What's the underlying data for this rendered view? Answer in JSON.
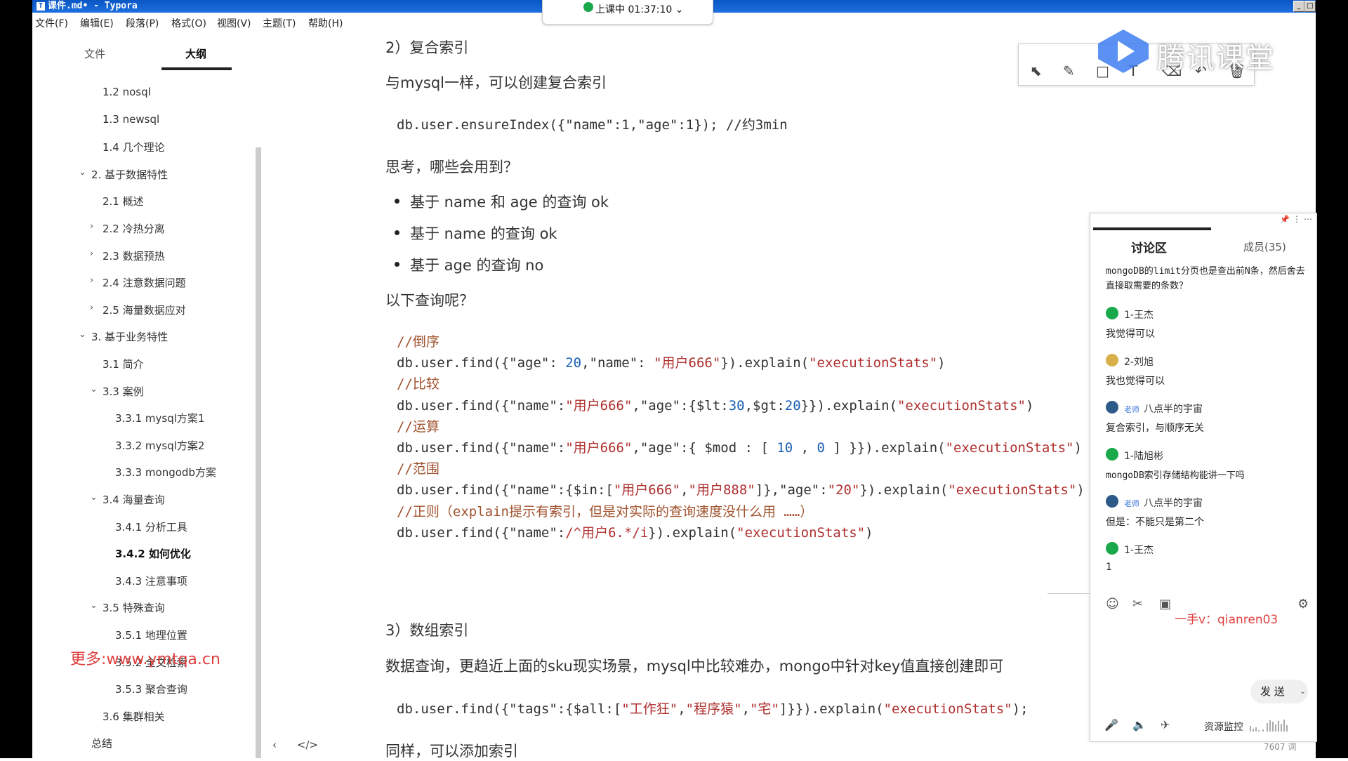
{
  "window": {
    "title": "课件.md• - Typora",
    "icon": "T",
    "controls": [
      "_",
      "□"
    ]
  },
  "menu": [
    "文件(F)",
    "编辑(E)",
    "段落(P)",
    "格式(O)",
    "视图(V)",
    "主题(T)",
    "帮助(H)"
  ],
  "live_status": {
    "text": "上课中 01:37:10",
    "chevron": "⌄"
  },
  "sidebar": {
    "tabs": {
      "files": "文件",
      "outline": "大纲"
    },
    "outline": [
      {
        "label": "1.2 nosql"
      },
      {
        "label": "1.3 newsql"
      },
      {
        "label": "1.4 几个理论"
      },
      {
        "label": "2. 基于数据特性",
        "chev": "⌄"
      },
      {
        "label": "2.1 概述"
      },
      {
        "label": "2.2 冷热分离",
        "chev": "›"
      },
      {
        "label": "2.3 数据预热",
        "chev": "›"
      },
      {
        "label": "2.4 注意数据问题",
        "chev": "›"
      },
      {
        "label": "2.5 海量数据应对",
        "chev": "›"
      },
      {
        "label": "3. 基于业务特性",
        "chev": "⌄"
      },
      {
        "label": "3.1 简介"
      },
      {
        "label": "3.3 案例",
        "chev": "⌄"
      },
      {
        "label": "3.3.1 mysql方案1"
      },
      {
        "label": "3.3.2 mysql方案2"
      },
      {
        "label": "3.3.3 mongodb方案"
      },
      {
        "label": "3.4 海量查询",
        "chev": "⌄"
      },
      {
        "label": "3.4.1 分析工具"
      },
      {
        "label": "3.4.2 如何优化"
      },
      {
        "label": "3.4.3 注意事项"
      },
      {
        "label": "3.5 特殊查询",
        "chev": "⌄"
      },
      {
        "label": "3.5.1 地理位置"
      },
      {
        "label": "3.5.2 全文检索"
      },
      {
        "label": "3.5.3 聚合查询"
      },
      {
        "label": "3.6 集群相关"
      },
      {
        "label": "总结"
      }
    ],
    "watermark": "更多:www.ymtqa.cn",
    "bottom_icons": {
      "collapse": "‹",
      "source": "</>"
    }
  },
  "doc": {
    "h_compound": "2）复合索引",
    "p_same_mysql": "与mysql一样，可以创建复合索引",
    "code_ensure": "db.user.ensureIndex({\"name\":1,\"age\":1});  //约3min",
    "p_think": "思考，哪些会用到？",
    "bullets": [
      "基于 name 和 age 的查询   ok",
      "基于 name 的查询   ok",
      "基于 age 的查询    no"
    ],
    "p_following": "以下查询呢？",
    "code_block": [
      {
        "comment": "//倒序"
      },
      {
        "code": [
          "db.user.find({\"age\": ",
          "20",
          ",\"name\": ",
          "\"用户666\"",
          "}).explain(",
          "\"executionStats\"",
          ")"
        ]
      },
      {
        "comment": "//比较"
      },
      {
        "code": [
          "db.user.find({\"name\":",
          "\"用户666\"",
          ",\"age\":{$lt:",
          "30",
          ",$gt:",
          "20",
          "}}).explain(",
          "\"executionStats\"",
          ")"
        ]
      },
      {
        "comment": "//运算"
      },
      {
        "code": [
          "db.user.find({\"name\":",
          "\"用户666\"",
          ",\"age\":{ $mod : [ ",
          "10",
          " , ",
          "0",
          " ] }}).explain(",
          "\"executionStats\"",
          ")"
        ]
      },
      {
        "comment": "//范围"
      },
      {
        "code": [
          "db.user.find({\"name\":{$in:[",
          "\"用户666\"",
          ",",
          "\"用户888\"",
          "]},\"age\":",
          "\"20\"",
          "}).explain(",
          "\"executionStats\"",
          ")"
        ]
      },
      {
        "comment": "//正则（explain提示有索引，但是对实际的查询速度没什么用  ……）"
      },
      {
        "code": [
          "db.user.find({\"name\":",
          "/^用户6.*/i",
          "}).explain(",
          "\"executionStats\"",
          ")"
        ]
      }
    ],
    "h_array": "3）数组索引",
    "p_array": "数据查询，更趋近上面的sku现实场景，mysql中比较难办，mongo中针对key值直接创建即可",
    "code_array": [
      "db.user.find({\"tags\":{$all:[",
      "\"工作狂\"",
      ",",
      "\"程序猿\"",
      ",",
      "\"宅\"",
      "]}}).explain(",
      "\"executionStats\"",
      ");"
    ],
    "p_also": "同样，可以添加索引"
  },
  "tencent": {
    "logo_text": "腾讯课堂",
    "tools": [
      "pointer-icon",
      "pen-icon",
      "rect-icon",
      "text-icon",
      "eraser-icon",
      "undo-icon",
      "trash-icon"
    ],
    "tool_glyphs": [
      "⬉",
      "✎",
      "□",
      "T",
      "⌫",
      "↶",
      "🗑"
    ]
  },
  "chat": {
    "header_icons": [
      "📌",
      "⋮",
      "⋯"
    ],
    "tab": "讨论区",
    "members": "成员(35)",
    "question": "mongoDB的limit分页也是查出前N条，然后舍去直接取需要的条数？",
    "messages": [
      {
        "user": "1-王杰",
        "text": "我觉得可以",
        "teacher": false
      },
      {
        "user": "2-刘旭",
        "text": "我也觉得可以",
        "teacher": false
      },
      {
        "user": "八点半的宇宙",
        "text": "复合索引，与顺序无关",
        "teacher": true
      },
      {
        "user": "1-陆旭彬",
        "text": "mongoDB索引存储结构能讲一下吗",
        "teacher": false
      },
      {
        "user": "八点半的宇宙",
        "text": "但是：不能只是第二个",
        "teacher": true
      },
      {
        "user": "1-王杰",
        "text": "1",
        "teacher": false
      }
    ],
    "teacher_badge": "老师",
    "red_note": "一手v：qianren03",
    "send": "发 送",
    "resource_monitor": "资源监控",
    "icons": {
      "emoji": "☺",
      "scissors": "✂",
      "image": "▣",
      "settings": "⚙",
      "mic": "🎤",
      "speaker": "🔈",
      "mute": "✈"
    }
  },
  "word_count": "7607 词",
  "colors": {
    "titlebar": "#1d6fe0",
    "comment": "#a0522d",
    "string": "#b03030",
    "number": "#1a5fb4",
    "live_dot": "#19a84a",
    "red_note": "#e04040"
  }
}
